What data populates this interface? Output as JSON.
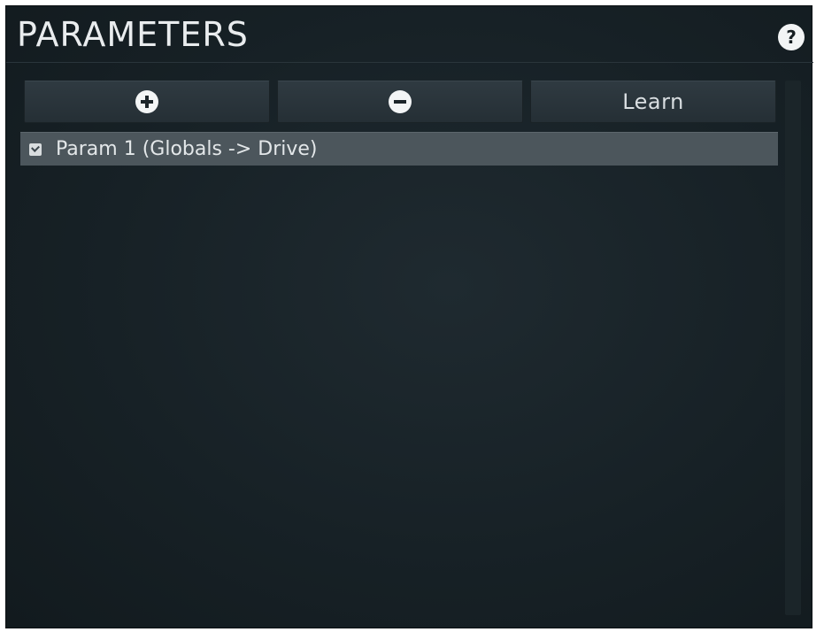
{
  "header": {
    "title": "PARAMETERS",
    "help_label": "?"
  },
  "toolbar": {
    "add_icon": "plus-circle-icon",
    "remove_icon": "minus-circle-icon",
    "learn_label": "Learn"
  },
  "list": {
    "items": [
      {
        "label": "Param 1 (Globals -> Drive)",
        "checked": true
      }
    ]
  },
  "colors": {
    "panel_background": "#172126",
    "button_background": "#2a343a",
    "selected_row": "#4c565c",
    "text": "#e3e7e9",
    "icon": "#f3f5f6"
  }
}
